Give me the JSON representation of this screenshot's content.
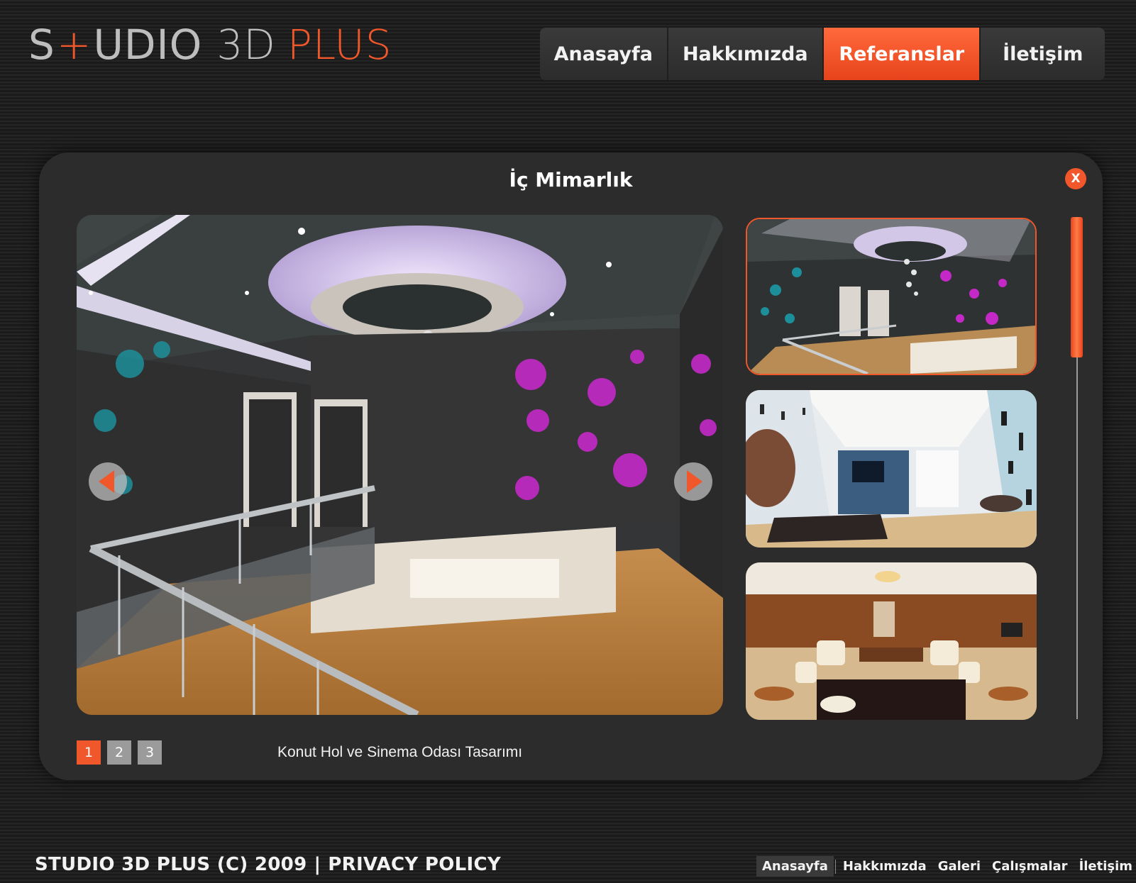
{
  "logo": {
    "part1": "S",
    "part2": "+",
    "part3": "UDIO",
    "part4": "3D",
    "part5": "PLUS"
  },
  "top_nav": [
    {
      "label": "Anasayfa",
      "active": false
    },
    {
      "label": "Hakkımızda",
      "active": false
    },
    {
      "label": "Referanslar",
      "active": true
    },
    {
      "label": "İletişim",
      "active": false
    }
  ],
  "gallery": {
    "title": "İç Mimarlık",
    "close_label": "X",
    "caption": "Konut Hol ve Sinema Odası Tasarımı",
    "pages": [
      "1",
      "2",
      "3"
    ],
    "active_page": "1"
  },
  "footer": {
    "copyright": "STUDIO 3D PLUS (C) 2009",
    "separator": "|",
    "privacy": "PRIVACY POLICY",
    "nav": [
      "Anasayfa",
      "Hakkımızda",
      "Galeri",
      "Çalışmalar",
      "İletişim"
    ]
  },
  "colors": {
    "accent": "#f0582b",
    "background": "#1c1c1c",
    "panel": "#2c2c2c"
  }
}
